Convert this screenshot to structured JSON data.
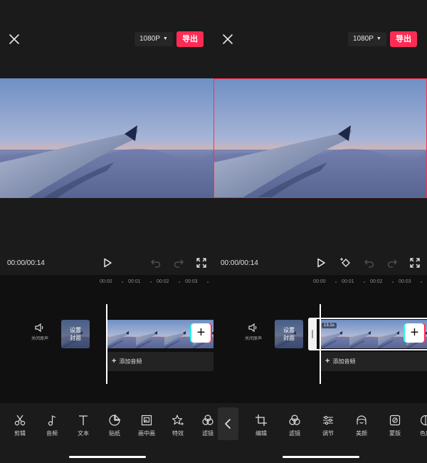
{
  "colors": {
    "accent": "#fe2c55",
    "accent_secondary": "#25f4ee",
    "background": "#1b1b1b",
    "timeline_bg": "#101010"
  },
  "left": {
    "header": {
      "resolution": "1080P",
      "export_label": "导出"
    },
    "playback": {
      "timecode": "00:00/00:14"
    },
    "ruler": [
      "00:00",
      "00:01",
      "00:02",
      "00:03"
    ],
    "mute": {
      "label": "关闭原声"
    },
    "cover": {
      "line1": "设置",
      "line2": "封面"
    },
    "add_audio_label": "添加音频",
    "toolbar": [
      {
        "label": "剪辑",
        "icon": "scissors-icon"
      },
      {
        "label": "音频",
        "icon": "music-note-icon"
      },
      {
        "label": "文本",
        "icon": "text-icon"
      },
      {
        "label": "贴纸",
        "icon": "sticker-icon"
      },
      {
        "label": "画中画",
        "icon": "picture-in-picture-icon"
      },
      {
        "label": "特效",
        "icon": "effects-star-icon"
      },
      {
        "label": "滤镜",
        "icon": "filter-icon"
      }
    ]
  },
  "right": {
    "header": {
      "resolution": "1080P",
      "export_label": "导出"
    },
    "playback": {
      "timecode": "00:00/00:14"
    },
    "ruler": [
      "00:00",
      "00:01",
      "00:02",
      "00:03"
    ],
    "mute": {
      "label": "关闭原声"
    },
    "cover": {
      "line1": "设置",
      "line2": "封面"
    },
    "clip": {
      "duration": "13.1s"
    },
    "add_audio_label": "添加音频",
    "toolbar": [
      {
        "label": "编辑",
        "icon": "crop-icon"
      },
      {
        "label": "滤镜",
        "icon": "filter-icon"
      },
      {
        "label": "调节",
        "icon": "sliders-icon"
      },
      {
        "label": "美颜",
        "icon": "beauty-face-icon"
      },
      {
        "label": "蒙版",
        "icon": "mask-icon"
      },
      {
        "label": "色度",
        "icon": "chroma-icon"
      }
    ]
  }
}
